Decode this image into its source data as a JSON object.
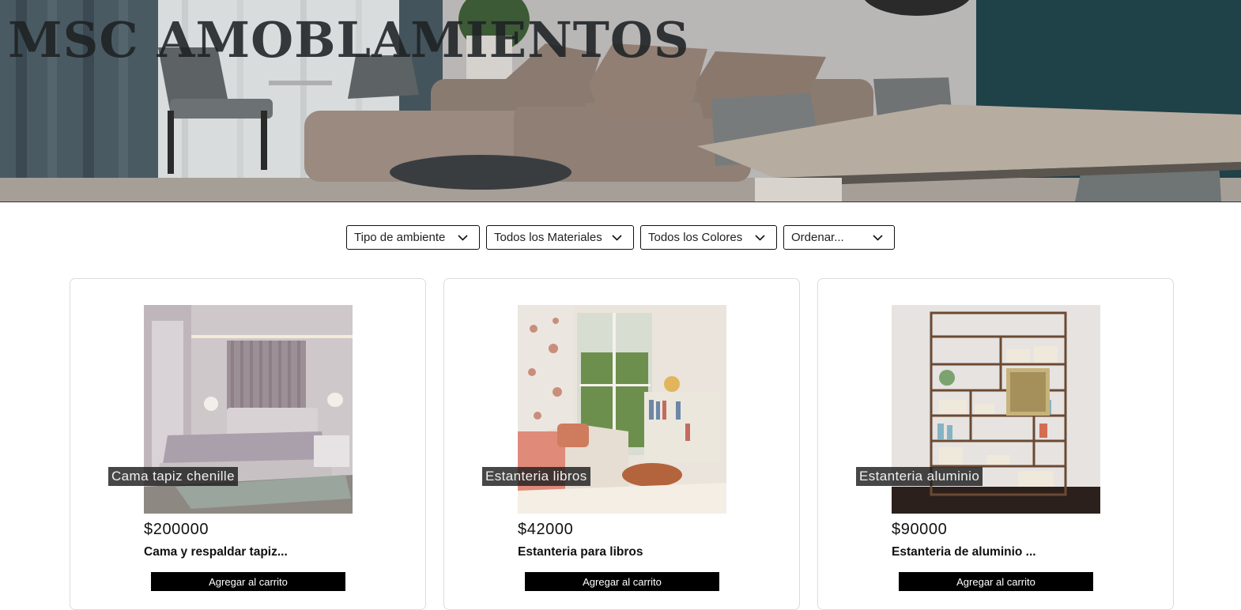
{
  "header": {
    "site_title": "MSC AMOBLAMIENTOS"
  },
  "filters": {
    "ambiente": "Tipo de ambiente",
    "materiales": "Todos los Materiales",
    "colores": "Todos los Colores",
    "ordenar": "Ordenar..."
  },
  "products": [
    {
      "caption": "Cama tapiz chenille",
      "price": "$200000",
      "name": "Cama y respaldar tapiz...",
      "button": "Agregar al carrito"
    },
    {
      "caption": "Estanteria libros",
      "price": "$42000",
      "name": "Estanteria para libros",
      "button": "Agregar al carrito"
    },
    {
      "caption": "Estanteria aluminio",
      "price": "$90000",
      "name": "Estanteria de aluminio ...",
      "button": "Agregar al carrito"
    }
  ],
  "colors": {
    "button_bg": "#000000",
    "border": "#dcdcdc",
    "title": "#1e2224"
  },
  "icons": [
    "chevron-down-icon"
  ]
}
